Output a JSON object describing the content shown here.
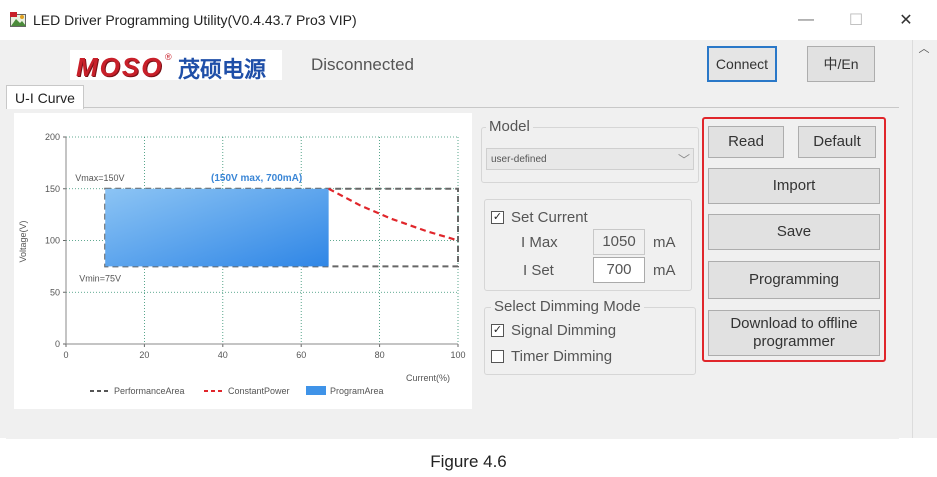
{
  "window": {
    "title": "LED Driver Programming Utility(V0.4.43.7 Pro3 VIP)",
    "minimize_glyph": "—",
    "maximize_glyph": "☐",
    "close_glyph": "✕"
  },
  "header": {
    "brand_latin": "MOSO",
    "brand_reg": "®",
    "brand_cn": "茂硕电源",
    "status": "Disconnected",
    "connect_label": "Connect",
    "lang_label": "中/En"
  },
  "tabs": [
    {
      "label": "U-I Curve"
    }
  ],
  "chart_data": {
    "type": "area",
    "ylabel": "Voltage(V)",
    "xlabel": "Current(%)",
    "x_ticks": [
      "0",
      "20",
      "40",
      "60",
      "80",
      "100"
    ],
    "y_ticks": [
      "0",
      "50",
      "100",
      "150",
      "200"
    ],
    "xlim": [
      0,
      100
    ],
    "ylim": [
      0,
      200
    ],
    "grid": true,
    "annotations": {
      "vmax": "Vmax=150V",
      "vmin": "Vmin=75V",
      "peak": "(150V max, 700mA)"
    },
    "performance_area": {
      "x": [
        10,
        100
      ],
      "y": [
        75,
        150
      ]
    },
    "program_area": {
      "x": [
        10,
        67
      ],
      "y": [
        75,
        150
      ]
    },
    "constant_power": {
      "x": [
        67,
        75,
        83,
        92,
        100
      ],
      "y": [
        150,
        134,
        121,
        109,
        100
      ]
    },
    "legend": [
      {
        "name": "PerformanceArea",
        "color": "#555555",
        "style": "dash"
      },
      {
        "name": "ConstantPower",
        "color": "#e0262b",
        "style": "dash"
      },
      {
        "name": "ProgramArea",
        "color": "#3f93e8",
        "style": "fill"
      }
    ],
    "legend_position": "bottom"
  },
  "model": {
    "group_label": "Model",
    "selected": "user-defined"
  },
  "current": {
    "set_current_label": "Set Current",
    "set_current_checked": true,
    "imax_label": "I Max",
    "imax_value": "1050",
    "imax_unit": "mA",
    "iset_label": "I Set",
    "iset_value": "700",
    "iset_unit": "mA"
  },
  "dimming": {
    "group_label": "Select Dimming Mode",
    "signal_label": "Signal Dimming",
    "signal_checked": true,
    "timer_label": "Timer Dimming",
    "timer_checked": false
  },
  "actions": {
    "read": "Read",
    "default": "Default",
    "import": "Import",
    "save": "Save",
    "programming": "Programming",
    "download_line1": "Download to offline",
    "download_line2": "programmer"
  },
  "caption": "Figure 4.6",
  "colors": {
    "accent_red": "#e0262b",
    "program_blue": "#3f93e8",
    "connect_border": "#2a78c8",
    "brand_red": "#c8202a",
    "brand_blue": "#1f4fa8"
  }
}
